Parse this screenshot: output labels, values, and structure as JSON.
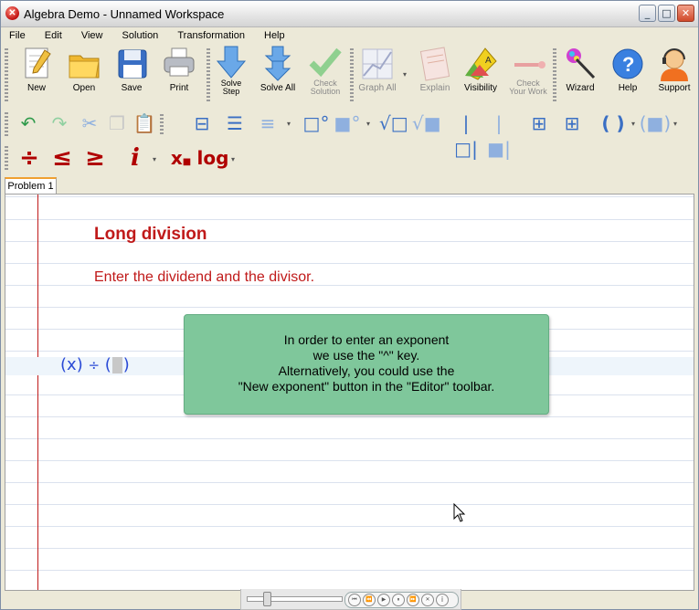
{
  "window": {
    "title": "Algebra Demo - Unnamed Workspace",
    "app_icon": "app-logo-icon"
  },
  "menu": [
    "File",
    "Edit",
    "View",
    "Solution",
    "Transformation",
    "Help"
  ],
  "toolbar_main": {
    "new": "New",
    "open": "Open",
    "save": "Save",
    "print": "Print",
    "solve_step_1": "Solve",
    "solve_step_2": "Step",
    "solve_all": "Solve All",
    "check_solution_1": "Check",
    "check_solution_2": "Solution",
    "graph_all": "Graph All",
    "explain": "Explain",
    "visibility": "Visibility",
    "check_work_1": "Check",
    "check_work_2": "Your Work",
    "wizard": "Wizard",
    "help": "Help",
    "support": "Support"
  },
  "toolbar_symbols": {
    "divide": "÷",
    "le": "≤",
    "ge": "≥",
    "imaginary": "i",
    "subscript": "x",
    "log": "log"
  },
  "tabs": [
    "Problem 1"
  ],
  "notebook": {
    "heading": "Long division",
    "prompt": "Enter the dividend and the divisor.",
    "expression": {
      "open1": "(",
      "var": "x",
      "close1": ")",
      "op": "÷",
      "open2": "(",
      "close2": ")"
    }
  },
  "tooltip": {
    "lines": [
      "In order to enter an exponent",
      "we use the \"^\" key.",
      "Alternatively, you could use the",
      "\"New exponent\" button in the \"Editor\" toolbar."
    ]
  },
  "colors": {
    "accent_red": "#c01a1a",
    "math_blue": "#2a4ad6",
    "tooltip_green": "#7fc79b"
  }
}
